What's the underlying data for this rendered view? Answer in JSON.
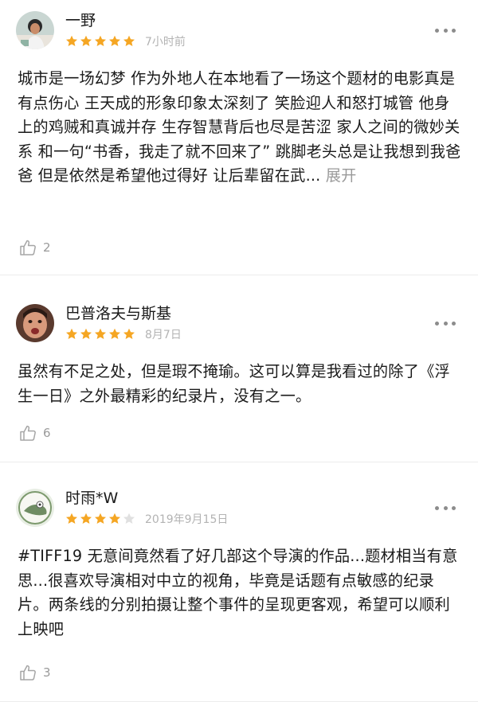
{
  "reviews": [
    {
      "username": "一野",
      "rating": 5,
      "time": "7小时前",
      "text": "城市是一场幻梦 作为外地人在本地看了一场这个题材的电影真是有点伤心 王天成的形象印象太深刻了 笑脸迎人和怒打城管 他身上的鸡贼和真诚并存 生存智慧背后也尽是苦涩 家人之间的微妙关系 和一句“书香，我走了就不回来了” 跳脚老头总是让我想到我爸爸 但是依然是希望他过得好 让后辈留在武...",
      "expand_label": "展开",
      "likes": "2",
      "avatar_icon": "person-photo-avatar"
    },
    {
      "username": "巴普洛夫与斯基",
      "rating": 5,
      "time": "8月7日",
      "text": "虽然有不足之处，但是瑕不掩瑜。这可以算是我看过的除了《浮生一日》之外最精彩的纪录片，没有之一。",
      "likes": "6",
      "avatar_icon": "face-photo-avatar"
    },
    {
      "username": "时雨*W",
      "rating": 4,
      "time": "2019年9月15日",
      "text": "#TIFF19 无意间竟然看了好几部这个导演的作品...题材相当有意思...很喜欢导演相对中立的视角，毕竟是话题有点敏感的纪录片。两条线的分别拍摄让整个事件的呈现更客观，希望可以顺利上映吧",
      "likes": "3",
      "avatar_icon": "cartoon-avatar"
    }
  ],
  "colors": {
    "star_filled": "#f5a623",
    "star_empty": "#e0e0e0",
    "meta_text": "#b3b3b3",
    "divider": "#ececec"
  }
}
